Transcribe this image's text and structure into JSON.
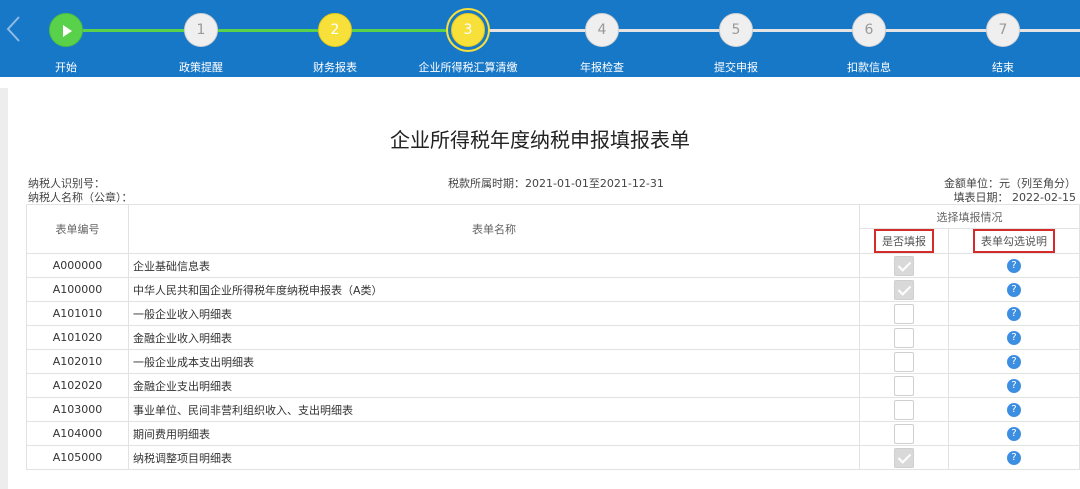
{
  "steps": [
    {
      "number": "",
      "label": "开始"
    },
    {
      "number": "1",
      "label": "政策提醒"
    },
    {
      "number": "2",
      "label": "财务报表"
    },
    {
      "number": "3",
      "label": "企业所得税汇算清缴"
    },
    {
      "number": "4",
      "label": "年报检查"
    },
    {
      "number": "5",
      "label": "提交申报"
    },
    {
      "number": "6",
      "label": "扣款信息"
    },
    {
      "number": "7",
      "label": "结束"
    }
  ],
  "colors": {
    "bar": "#1878c8",
    "done": "#5ad14b",
    "active": "#f8e03a",
    "highlight": "#d42b2b"
  },
  "icons": {
    "back": "chevron-left-icon",
    "start": "play-icon",
    "help": "question-icon",
    "check": "check-icon"
  },
  "form": {
    "title": "企业所得税年度纳税申报填报表单",
    "taxpayer_id_label": "纳税人识别号：",
    "taxpayer_name_label": "纳税人名称（公章）：",
    "period": "税款所属时期：2021-01-01至2021-12-31",
    "unit": "金额单位：元（列至角分）",
    "fill_date": "填表日期： 2022-02-15"
  },
  "table": {
    "headers": {
      "code": "表单编号",
      "name": "表单名称",
      "group": "选择填报情况",
      "fill": "是否填报",
      "note": "表单勾选说明"
    },
    "help_glyph": "?",
    "rows": [
      {
        "code": "A000000",
        "name": "企业基础信息表",
        "checked": true
      },
      {
        "code": "A100000",
        "name": "中华人民共和国企业所得税年度纳税申报表（A类）",
        "checked": true
      },
      {
        "code": "A101010",
        "name": "一般企业收入明细表",
        "checked": false
      },
      {
        "code": "A101020",
        "name": "金融企业收入明细表",
        "checked": false
      },
      {
        "code": "A102010",
        "name": "一般企业成本支出明细表",
        "checked": false
      },
      {
        "code": "A102020",
        "name": "金融企业支出明细表",
        "checked": false
      },
      {
        "code": "A103000",
        "name": "事业单位、民间非营利组织收入、支出明细表",
        "checked": false
      },
      {
        "code": "A104000",
        "name": "期间费用明细表",
        "checked": false
      },
      {
        "code": "A105000",
        "name": "纳税调整项目明细表",
        "checked": true
      }
    ]
  }
}
